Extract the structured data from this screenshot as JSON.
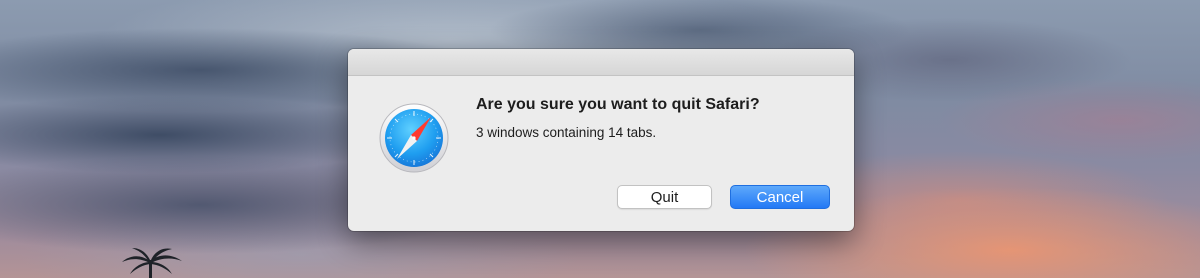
{
  "dialog": {
    "title": "Are you sure you want to quit Safari?",
    "message": "3 windows containing 14 tabs.",
    "app_icon": "safari-compass-icon",
    "buttons": {
      "quit_label": "Quit",
      "cancel_label": "Cancel"
    }
  },
  "colors": {
    "default_button": "#2f82f7",
    "dialog_background": "#ececec"
  }
}
